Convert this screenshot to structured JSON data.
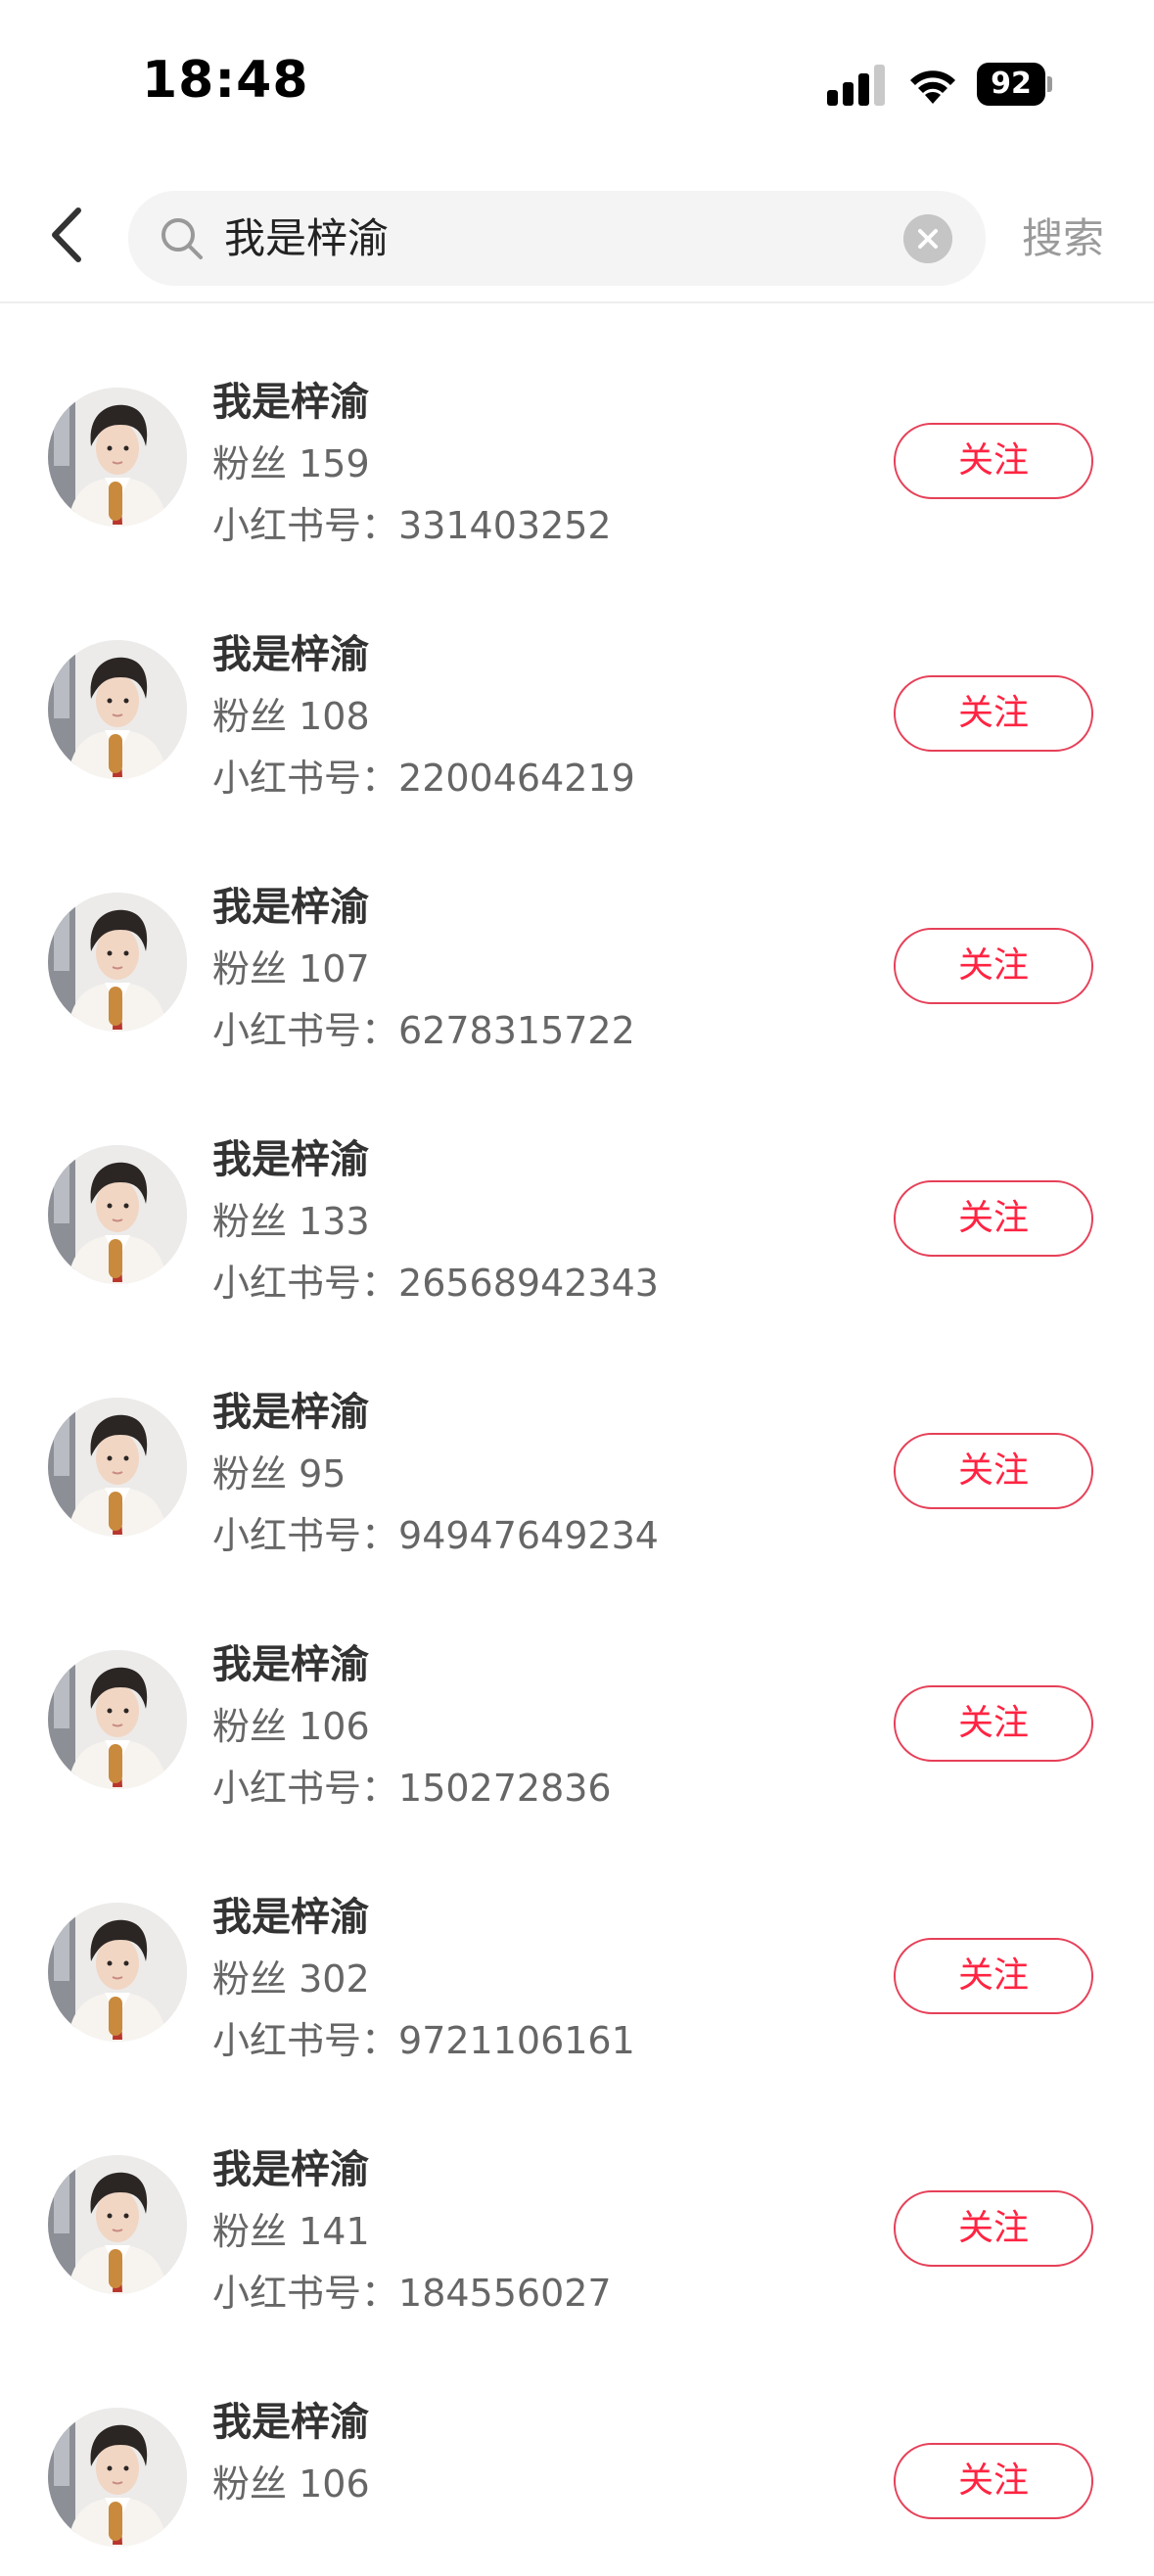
{
  "status_bar": {
    "time": "18:48",
    "battery": "92",
    "icons": [
      "cellular-signal-icon",
      "wifi-icon",
      "battery-icon"
    ]
  },
  "search": {
    "query": "我是梓渝",
    "submit_label": "搜索",
    "icons": [
      "back-chevron-icon",
      "search-icon",
      "clear-icon"
    ]
  },
  "colors": {
    "accent": "#ff2442",
    "muted_text": "#666666",
    "search_bg": "#f4f4f4"
  },
  "results": [
    {
      "name": "我是梓渝",
      "fans_label": "粉丝",
      "fans": "159",
      "id_label": "小红书号：",
      "id": "331403252",
      "follow_label": "关注"
    },
    {
      "name": "我是梓渝",
      "fans_label": "粉丝",
      "fans": "108",
      "id_label": "小红书号：",
      "id": "2200464219",
      "follow_label": "关注"
    },
    {
      "name": "我是梓渝",
      "fans_label": "粉丝",
      "fans": "107",
      "id_label": "小红书号：",
      "id": "6278315722",
      "follow_label": "关注"
    },
    {
      "name": "我是梓渝",
      "fans_label": "粉丝",
      "fans": "133",
      "id_label": "小红书号：",
      "id": "26568942343",
      "follow_label": "关注"
    },
    {
      "name": "我是梓渝",
      "fans_label": "粉丝",
      "fans": "95",
      "id_label": "小红书号：",
      "id": "94947649234",
      "follow_label": "关注"
    },
    {
      "name": "我是梓渝",
      "fans_label": "粉丝",
      "fans": "106",
      "id_label": "小红书号：",
      "id": "150272836",
      "follow_label": "关注"
    },
    {
      "name": "我是梓渝",
      "fans_label": "粉丝",
      "fans": "302",
      "id_label": "小红书号：",
      "id": "9721106161",
      "follow_label": "关注"
    },
    {
      "name": "我是梓渝",
      "fans_label": "粉丝",
      "fans": "141",
      "id_label": "小红书号：",
      "id": "184556027",
      "follow_label": "关注"
    },
    {
      "name": "我是梓渝",
      "fans_label": "粉丝",
      "fans": "106",
      "id_label": "",
      "id": "",
      "follow_label": "关注"
    }
  ]
}
